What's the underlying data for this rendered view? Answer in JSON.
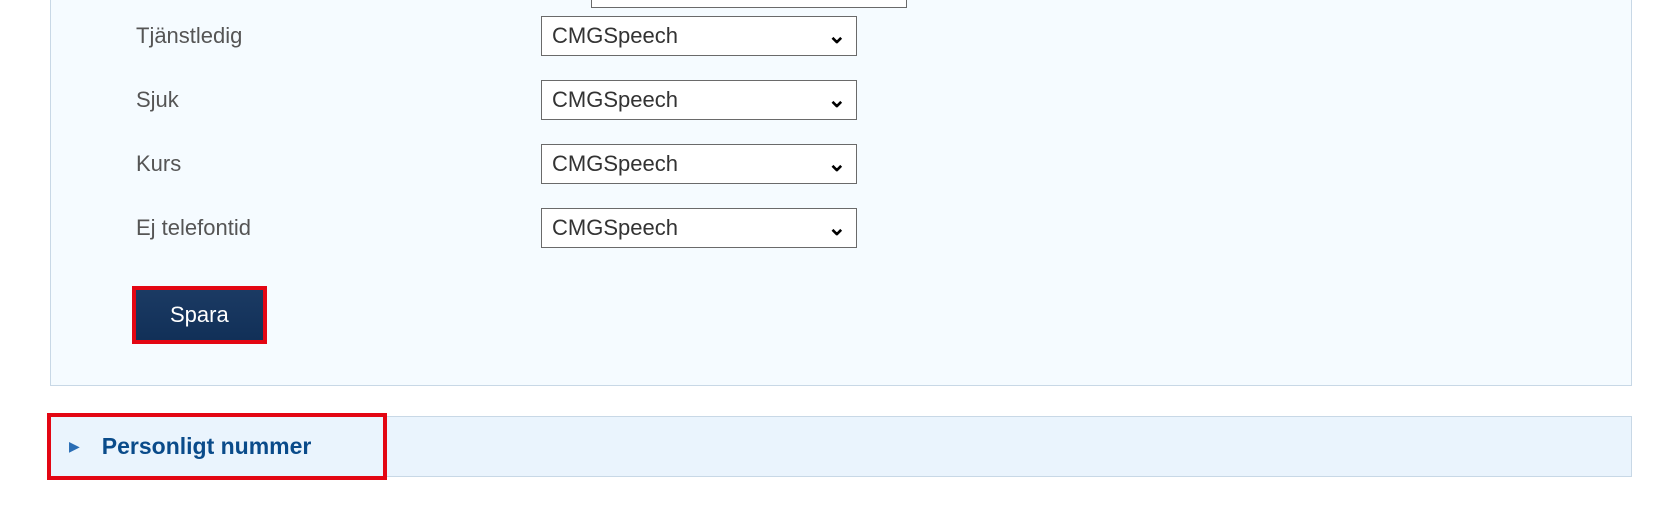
{
  "form": {
    "rows": [
      {
        "label": "Tjänstledig",
        "value": "CMGSpeech"
      },
      {
        "label": "Sjuk",
        "value": "CMGSpeech"
      },
      {
        "label": "Kurs",
        "value": "CMGSpeech"
      },
      {
        "label": "Ej telefontid",
        "value": "CMGSpeech"
      }
    ],
    "save_label": "Spara"
  },
  "accordion": {
    "title": "Personligt nummer"
  }
}
